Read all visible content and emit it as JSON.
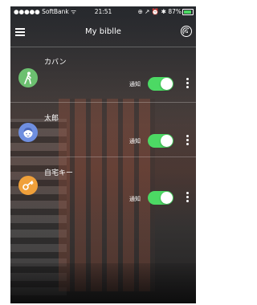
{
  "status_bar": {
    "carrier": "●●●●● SoftBank ᯤ",
    "time": "21:51",
    "right": "⊕ ↗ ⏰ ✱ 87%",
    "battery_level": 0.87
  },
  "navbar": {
    "title": "My biblle"
  },
  "devices": [
    {
      "name": "カバン",
      "notify_label": "通知",
      "enabled": true,
      "avatar_color": "#6cc070",
      "icon": "person-walking-icon"
    },
    {
      "name": "太郎",
      "notify_label": "通知",
      "enabled": true,
      "avatar_color": "#6f8fe0",
      "icon": "child-face-icon"
    },
    {
      "name": "自宅キー",
      "notify_label": "通知",
      "enabled": true,
      "avatar_color": "#f0a03a",
      "icon": "key-icon"
    }
  ],
  "colors": {
    "toggle_on": "#4cd964"
  }
}
